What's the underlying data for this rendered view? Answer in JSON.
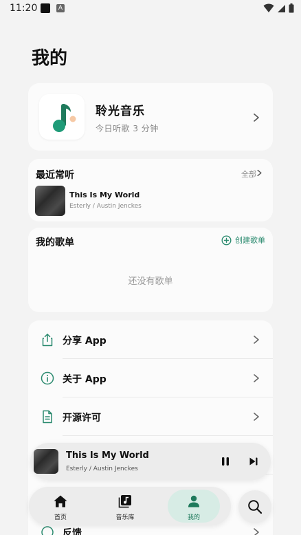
{
  "status_bar": {
    "time": "11:20",
    "a_label": "A"
  },
  "page": {
    "title": "我的"
  },
  "app_card": {
    "name": "聆光音乐",
    "today_listen": "今日听歌 3 分钟"
  },
  "recent": {
    "title": "最近常听",
    "all_label": "全部",
    "song": {
      "title": "This Is My World",
      "artist": "Esterly / Austin Jenckes"
    }
  },
  "playlists": {
    "title": "我的歌单",
    "create_label": "创建歌单",
    "empty_text": "还没有歌单"
  },
  "menu": {
    "items": [
      {
        "label": "分享 App",
        "icon": "share-icon"
      },
      {
        "label": "关于 App",
        "icon": "info-icon"
      },
      {
        "label": "开源许可",
        "icon": "license-icon"
      },
      {
        "label": "",
        "icon": "settings-icon"
      },
      {
        "label": "反馈",
        "icon": "feedback-icon"
      }
    ]
  },
  "mini_player": {
    "title": "This Is My World",
    "artist": "Esterly / Austin Jenckes"
  },
  "nav": {
    "items": [
      {
        "label": "首页",
        "icon": "home-icon"
      },
      {
        "label": "音乐库",
        "icon": "library-icon"
      },
      {
        "label": "我的",
        "icon": "profile-icon",
        "active": true
      }
    ]
  },
  "colors": {
    "accent": "#2a8a6e",
    "background": "#f3f3f3",
    "card": "#fbfbfb"
  }
}
